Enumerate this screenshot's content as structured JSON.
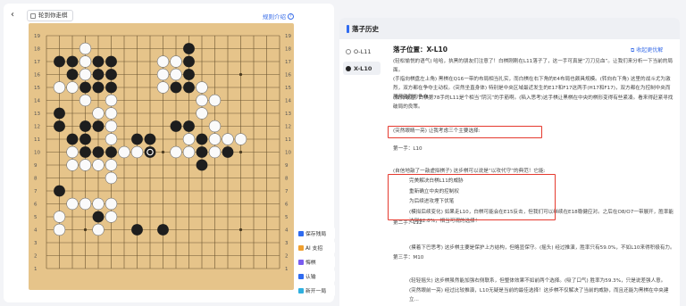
{
  "header": {
    "back_icon": "‹",
    "title": "轮到你走棋",
    "rules_link": "规则介绍",
    "rules_icon": "?"
  },
  "board": {
    "size": 19,
    "col_labels": [
      "A",
      "B",
      "C",
      "D",
      "E",
      "F",
      "G",
      "H",
      "J",
      "K",
      "L",
      "M",
      "N",
      "O",
      "P",
      "Q",
      "R",
      "S",
      "T"
    ],
    "row_labels": [
      "19",
      "18",
      "17",
      "16",
      "15",
      "14",
      "13",
      "12",
      "11",
      "10",
      "9",
      "8",
      "7",
      "6",
      "5",
      "4",
      "3",
      "2",
      "1"
    ],
    "black_stones": [
      [
        "B",
        17
      ],
      [
        "C",
        17
      ],
      [
        "C",
        16
      ],
      [
        "E",
        17
      ],
      [
        "E",
        16
      ],
      [
        "F",
        17
      ],
      [
        "F",
        16
      ],
      [
        "F",
        15
      ],
      [
        "D",
        15
      ],
      [
        "E",
        15
      ],
      [
        "B",
        13
      ],
      [
        "B",
        12
      ],
      [
        "C",
        11
      ],
      [
        "D",
        11
      ],
      [
        "D",
        12
      ],
      [
        "E",
        12
      ],
      [
        "D",
        10
      ],
      [
        "E",
        10
      ],
      [
        "F",
        10
      ],
      [
        "B",
        7
      ],
      [
        "E",
        5
      ],
      [
        "H",
        4
      ],
      [
        "K",
        4
      ],
      [
        "M",
        18
      ],
      [
        "M",
        17
      ],
      [
        "M",
        16
      ],
      [
        "L",
        15
      ],
      [
        "M",
        15
      ],
      [
        "L",
        12
      ],
      [
        "M",
        12
      ],
      [
        "N",
        11
      ],
      [
        "N",
        10
      ],
      [
        "P",
        10
      ],
      [
        "N",
        9
      ],
      [
        "H",
        11
      ],
      [
        "J",
        11
      ]
    ],
    "white_stones": [
      [
        "D",
        18
      ],
      [
        "D",
        17
      ],
      [
        "D",
        16
      ],
      [
        "C",
        15
      ],
      [
        "B",
        15
      ],
      [
        "D",
        14
      ],
      [
        "F",
        14
      ],
      [
        "F",
        13
      ],
      [
        "E",
        13
      ],
      [
        "F",
        12
      ],
      [
        "C",
        10
      ],
      [
        "C",
        9
      ],
      [
        "D",
        9
      ],
      [
        "E",
        9
      ],
      [
        "F",
        9
      ],
      [
        "G",
        10
      ],
      [
        "H",
        10
      ],
      [
        "F",
        11
      ],
      [
        "F",
        8
      ],
      [
        "C",
        6
      ],
      [
        "D",
        6
      ],
      [
        "E",
        6
      ],
      [
        "F",
        5
      ],
      [
        "F",
        6
      ],
      [
        "B",
        5
      ],
      [
        "B",
        4
      ],
      [
        "E",
        4
      ],
      [
        "K",
        17
      ],
      [
        "L",
        17
      ],
      [
        "K",
        16
      ],
      [
        "L",
        16
      ],
      [
        "K",
        15
      ],
      [
        "N",
        15
      ],
      [
        "N",
        14
      ],
      [
        "N",
        13
      ],
      [
        "O",
        14
      ],
      [
        "M",
        11
      ],
      [
        "O",
        11
      ],
      [
        "P",
        11
      ],
      [
        "Q",
        11
      ],
      [
        "O",
        12
      ],
      [
        "M",
        10
      ],
      [
        "O",
        10
      ],
      [
        "L",
        10
      ]
    ],
    "last_move": [
      "J",
      10
    ],
    "marked_move": [
      "J",
      10
    ]
  },
  "side_buttons": [
    {
      "label": "保存残局",
      "icon": "save-icon",
      "color": "#2f6bf0"
    },
    {
      "label": "AI 支招",
      "icon": "ai-bulb-icon",
      "color": "#f0a030"
    },
    {
      "label": "悔棋",
      "icon": "undo-icon",
      "color": "#7a5cf0"
    },
    {
      "label": "认输",
      "icon": "flag-icon",
      "color": "#2f6bf0"
    },
    {
      "label": "新开一局",
      "icon": "new-game-icon",
      "color": "#2fb0e0"
    }
  ],
  "history": {
    "title": "落子历史",
    "moves": [
      {
        "label": "O-L11",
        "color": "white",
        "active": false
      },
      {
        "label": "X-L10",
        "color": "black",
        "active": true
      }
    ],
    "position_title": "落子位置：X-L10",
    "collapse_label": "收起更优解",
    "paragraphs": [
      "(轻松愉悦的语气) 哈哈，执黑的朋友们注意了！白棋刚刚在L11落子了，这一手可真是“刀刀见血”。让我们来分析一下当前的局面。",
      "(手指向棋盘左上角) 黑棋在Q16一带的布局相当扎实，而白棋在右下角的E4布局也颇具规模。(转向右下角) 这里的战斗尤为激烈，双方都在争夺主动权。(突然坐直身体) 特别是中央区域最近发生的E17和F17这两手(H17和F17)，双方都在为控制中央而展开激烈的争夺。",
      "(微微皱眉) 白棋第78手的L11是个相当“阴沉”的手筋啊。(陷入思考)这手棋让黑棋在中央的棋形变得有些紧凑。看来得赶紧寻找破局的良策。",
      "(突然眼睛一亮) 让我考虑三个主要选择:",
      "第一手：L10",
      "(自信地敲了一敲虚拟棋子) 这步棋可以说是“以攻代守”的典范！它能:",
      "完美解决白棋L11的威胁",
      "重新确立中央的控制权",
      "为后续进攻埋下伏笔",
      "(模拟后续变化) 如果走L10，白棋可能会在E15反击，但我们可以继续在E18稳健应对。之后在O8/O7一带展开，胜率能达到62.8%，相当可观的选择！",
      "第二手：L12",
      "(摸着下巴思考) 这步棋主要是保护上方结构，但略显保守。(摇头) 经过推演，胜率只有59.0%，不如L10来得积极有力。",
      "第三手：M10",
      "(轻轻摇头) 这步棋虽然能加强右侧联系，但整体效果不如前两个选择。(吸了口气) 胜率为59.3%，只是说差强人意。",
      "(突然眼前一亮) 经过比较推演，L10无疑是当前的最佳选择！这步棋不仅解决了当前的威胁，而且还能为黑棋在中央建立..."
    ]
  }
}
